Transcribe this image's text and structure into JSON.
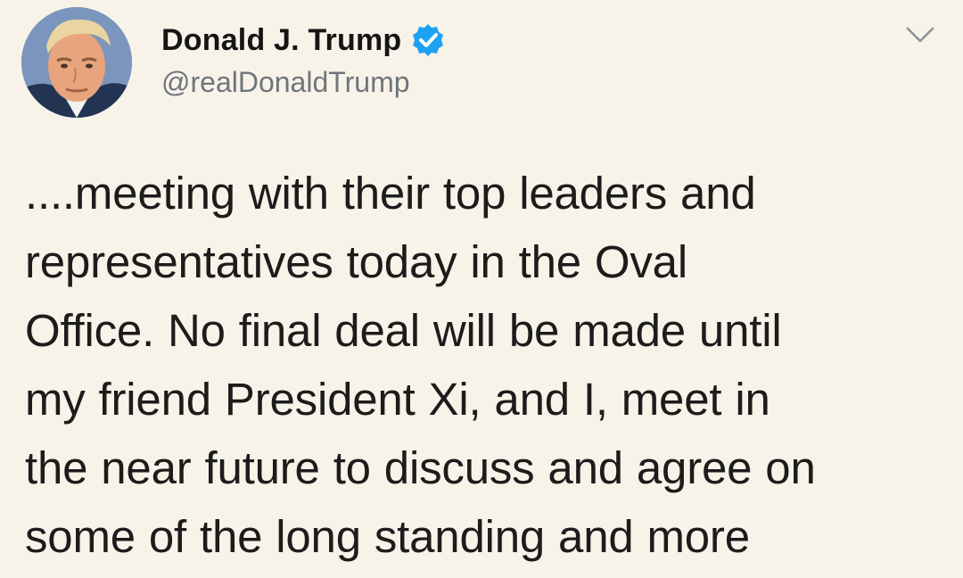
{
  "author": {
    "display_name": "Donald J. Trump",
    "handle": "@realDonaldTrump",
    "verified": true,
    "verified_color": "#1da1f2",
    "avatar_icon": "profile-photo"
  },
  "menu": {
    "icon": "chevron-down-icon"
  },
  "tweet": {
    "lines": [
      "....meeting with their top leaders and",
      "representatives today in the Oval",
      "Office. No final deal will be made until",
      "my friend President Xi, and I, meet in",
      "the near future to discuss and agree on",
      "some of the long standing and more"
    ]
  },
  "colors": {
    "background": "#f8f3e9",
    "text": "#1c1c1c",
    "handle": "#6f757a"
  }
}
